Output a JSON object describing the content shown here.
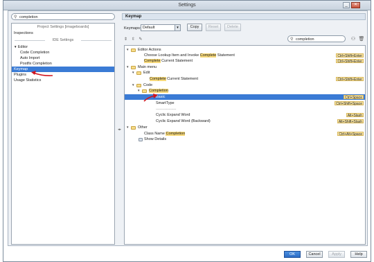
{
  "window": {
    "title": "Settings"
  },
  "left": {
    "search_value": "completion",
    "section_project": "Project Settings [imageboards]",
    "section_ide": "IDE Settings",
    "items": [
      {
        "label": "Inspections"
      },
      {
        "label": "Editor"
      },
      {
        "label": "Code Completion"
      },
      {
        "label": "Auto Import"
      },
      {
        "label": "Postfix Completion"
      },
      {
        "label": "Keymap"
      },
      {
        "label": "Plugins"
      },
      {
        "label": "Usage Statistics"
      }
    ]
  },
  "right": {
    "header": "Keymap",
    "keymaps_label": "Keymaps:",
    "keymap_value": "Default",
    "copy": "Copy",
    "reset": "Reset",
    "delete": "Delete",
    "search_value": "completion",
    "rows": [
      {
        "label": "Editor Actions"
      },
      {
        "pre": "Choose Lookup Item and Invoke ",
        "hl": "Complete",
        "post": " Statement",
        "shortcut": "Ctrl+Shift+Enter"
      },
      {
        "pre": "",
        "hl": "Complete",
        "post": " Current Statement",
        "shortcut": "Ctrl+Shift+Enter"
      },
      {
        "label": "Main menu"
      },
      {
        "label": "Edit"
      },
      {
        "pre": "",
        "hl": "Complete",
        "post": " Current Statement",
        "shortcut": "Ctrl+Shift+Enter"
      },
      {
        "label": "Code"
      },
      {
        "pre": "",
        "hl": "Completion",
        "post": ""
      },
      {
        "label": "Basic",
        "shortcut": "Ctrl+Space"
      },
      {
        "label": "SmartType",
        "shortcut": "Ctrl+Shift+Space"
      },
      {
        "label": "----------------"
      },
      {
        "label": "Cyclic Expand Word",
        "shortcut": "Alt+Slash"
      },
      {
        "label": "Cyclic Expand Word (Backward)",
        "shortcut": "Alt+Shift+Slash"
      },
      {
        "label": "Other"
      },
      {
        "pre": "Class Name ",
        "hl": "Completion",
        "post": "",
        "shortcut": "Ctrl+Alt+Space"
      },
      {
        "label": "Show Details"
      }
    ]
  },
  "footer": {
    "ok": "OK",
    "cancel": "Cancel",
    "apply": "Apply",
    "help": "Help"
  },
  "colors": {
    "selection": "#3a7bd5",
    "highlight": "#f7d97a",
    "arrow": "#d0141e"
  }
}
